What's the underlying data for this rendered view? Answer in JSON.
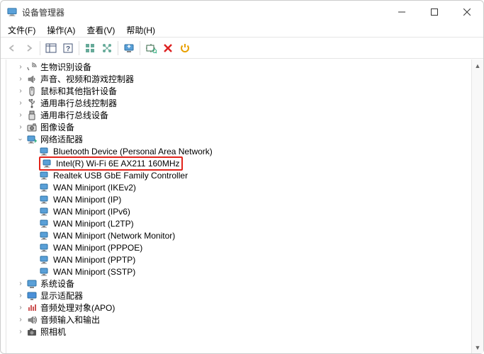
{
  "window": {
    "title": "设备管理器"
  },
  "menu": {
    "file": "文件(F)",
    "action": "操作(A)",
    "view": "查看(V)",
    "help": "帮助(H)"
  },
  "tree": {
    "biometric": "生物识别设备",
    "sound": "声音、视频和游戏控制器",
    "mouse": "鼠标和其他指针设备",
    "usb1": "通用串行总线控制器",
    "usb2": "通用串行总线设备",
    "image": "图像设备",
    "network": "网络适配器",
    "net_children": {
      "bt": "Bluetooth Device (Personal Area Network)",
      "wifi": "Intel(R) Wi-Fi 6E AX211 160MHz",
      "realtek": "Realtek USB GbE Family Controller",
      "ikev2": "WAN Miniport (IKEv2)",
      "ip": "WAN Miniport (IP)",
      "ipv6": "WAN Miniport (IPv6)",
      "l2tp": "WAN Miniport (L2TP)",
      "nm": "WAN Miniport (Network Monitor)",
      "pppoe": "WAN Miniport (PPPOE)",
      "pptp": "WAN Miniport (PPTP)",
      "sstp": "WAN Miniport (SSTP)"
    },
    "system": "系统设备",
    "display": "显示适配器",
    "audio_apo": "音频处理对象(APO)",
    "audio_io": "音频输入和输出",
    "camera": "照相机"
  }
}
